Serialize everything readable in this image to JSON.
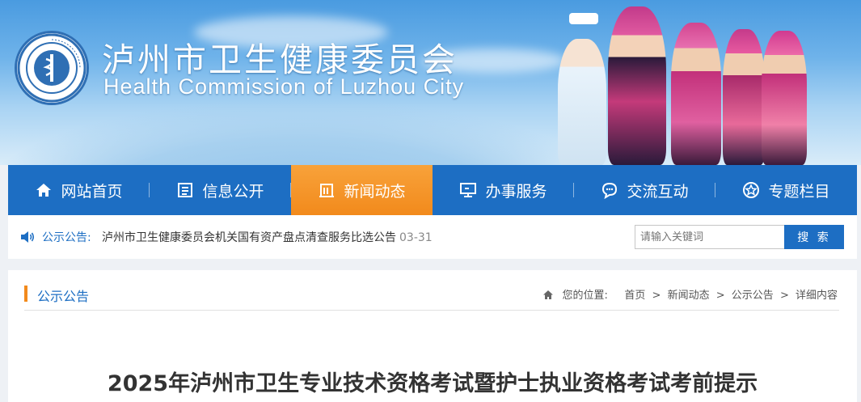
{
  "header": {
    "title_cn": "泸州市卫生健康委员会",
    "title_en": "Health Commission of Luzhou City",
    "logo_icon": "health-commission-emblem-icon"
  },
  "nav": {
    "items": [
      {
        "label": "网站首页",
        "icon": "home-icon"
      },
      {
        "label": "信息公开",
        "icon": "document-list-icon"
      },
      {
        "label": "新闻动态",
        "icon": "building-icon",
        "active": true
      },
      {
        "label": "办事服务",
        "icon": "monitor-icon"
      },
      {
        "label": "交流互动",
        "icon": "chat-bubble-icon"
      },
      {
        "label": "专题栏目",
        "icon": "star-circle-icon"
      }
    ]
  },
  "notice": {
    "label": "公示公告:",
    "text": "泸州市卫生健康委员会机关国有资产盘点清查服务比选公告",
    "date": "03-31"
  },
  "search": {
    "placeholder": "请输入关键词",
    "button": "搜 索"
  },
  "breadcrumb": {
    "section": "公示公告",
    "prefix": "您的位置:",
    "items": [
      "首页",
      "新闻动态",
      "公示公告",
      "详细内容"
    ]
  },
  "article": {
    "title": "2025年泸州市卫生专业技术资格考试暨护士执业资格考试考前提示"
  },
  "colors": {
    "primary": "#1d6ec3",
    "accent": "#f28a1c"
  }
}
